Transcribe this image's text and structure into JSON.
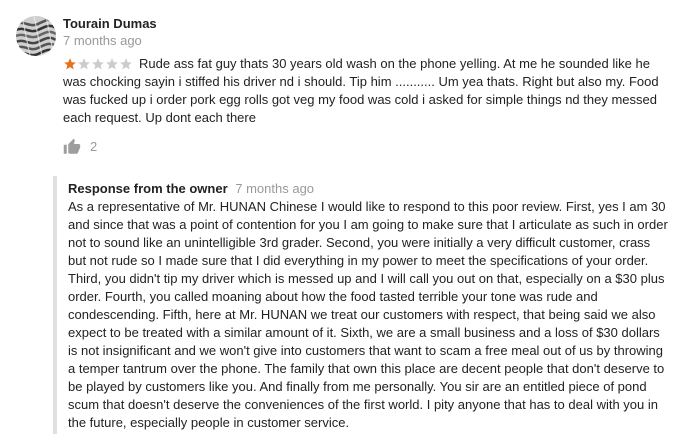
{
  "review": {
    "author": "Tourain Dumas",
    "time": "7 months ago",
    "rating": {
      "value": 1,
      "max": 5,
      "filled_color": "#e7711b",
      "empty_color": "#cccccc"
    },
    "text": "Rude ass fat guy thats 30 years old wash on the phone yelling. At me he sounded like he was chocking sayin i stiffed his driver nd i should. Tip him ........... Um yea thats. Right but also my. Food was fucked up i order pork egg rolls got veg my food was cold i asked for simple things nd they messed each request. Up dont each there",
    "helpful": {
      "icon": "thumbs-up-icon",
      "count": "2"
    }
  },
  "owner_response": {
    "title": "Response from the owner",
    "time": "7 months ago",
    "text": "As a representative of Mr. HUNAN Chinese I would like to respond to this poor review. First, yes I am 30 and since that was a point of contention for you I am going to make sure that I articulate as such in order not to sound like an unintelligible 3rd grader. Second, you were initially a very difficult customer, crass but not rude so I made sure that I did everything in my power to meet the specifications of your order. Third, you didn't tip my driver which is messed up and I will call you out on that, especially on a $30 plus order. Fourth, you called moaning about how the food tasted terrible your tone was rude and condescending. Fifth, here at Mr. HUNAN we treat our customers with respect, that being said we also expect to be treated with a similar amount of it. Sixth, we are a small business and a loss of $30 dollars is not insignificant and we won't give into customers that want to scam a free meal out of us by throwing a temper tantrum over the phone. The family that own this place are decent people that don't deserve to be played by customers like you. And finally from me personally. You sir are an entitled piece of pond scum that doesn't deserve the conveniences of the first world. I pity anyone that has to deal with you in the future, especially people in customer service."
  }
}
